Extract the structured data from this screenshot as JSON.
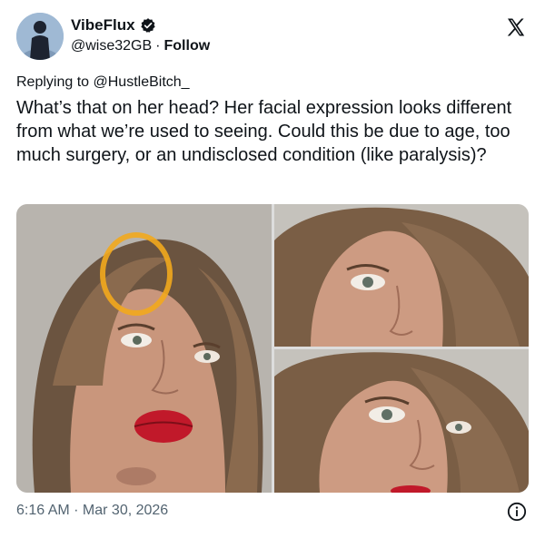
{
  "author": {
    "display_name": "VibeFlux",
    "handle": "@wise32GB",
    "separator": "·",
    "follow_label": "Follow",
    "verified": true
  },
  "reply": {
    "prefix": "Replying to",
    "to": "@HustleBitch_"
  },
  "tweet": {
    "text": "What’s that on her head? Her facial expression looks different from what we’re used to seeing. Could this be due to age, too much surgery, or an undisclosed condition (like paralysis)?"
  },
  "media": {
    "count": 3,
    "highlight_color": "#f2a81d"
  },
  "meta": {
    "timestamp": "6:16 AM · Mar 30, 2026"
  },
  "icons": {
    "logo": "x-logo-icon",
    "verified": "verified-badge-icon",
    "info": "info-icon"
  }
}
